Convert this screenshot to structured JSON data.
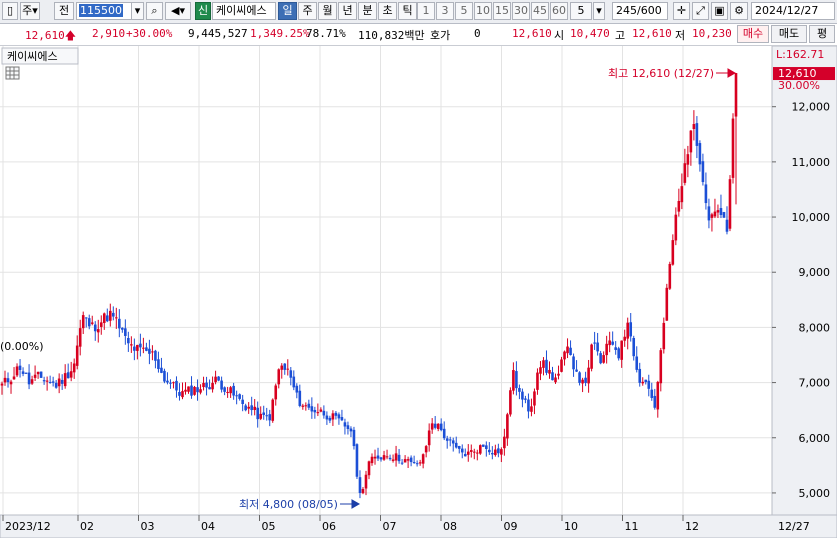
{
  "toolbar": {
    "menu1": "주",
    "menu2": "전",
    "stock_code": "115500",
    "credit_badge": "신",
    "stock_name": "케이씨에스",
    "periods": [
      "일",
      "주",
      "월",
      "년",
      "분",
      "초",
      "틱"
    ],
    "selected_period": "일",
    "intervals": [
      "1",
      "3",
      "5",
      "10",
      "15",
      "30",
      "45",
      "60"
    ],
    "custom_interval": "5",
    "count": "245",
    "count_max": "/600",
    "date": "2024/12/27"
  },
  "quote": {
    "price": "12,610",
    "change": "2,910",
    "change_pct": "+30.00%",
    "volume": "9,445,527",
    "volume_ratio": "1,349.25%",
    "turnover_pct": "78.71%",
    "amount": "110,832백만",
    "hoga_label": "호가",
    "hoga_value": "0",
    "hoga_price": "12,610",
    "open_label": "시",
    "open": "10,470",
    "high_label": "고",
    "high": "12,610",
    "low_label": "저",
    "low": "10,230",
    "buy_button": "매수",
    "sell_button": "매도",
    "avg_button": "평"
  },
  "chart_panel": {
    "stock_label": "케이씨에스",
    "left_edge_label": "(0.00%)",
    "right_top_label": "L:162.71",
    "current_price_tag": "12,610",
    "current_pct_tag": "30.00%"
  },
  "chart_data": {
    "type": "candlestick",
    "title": "",
    "ylim": [
      4600,
      13100
    ],
    "y_ticks": [
      5000,
      6000,
      7000,
      8000,
      9000,
      10000,
      11000,
      12000
    ],
    "y_tick_labels": [
      "5,000",
      "6,000",
      "7,000",
      "8,000",
      "9,000",
      "10,000",
      "11,000",
      "12,000"
    ],
    "x_tick_labels": [
      "2023/12",
      "02",
      "03",
      "04",
      "05",
      "06",
      "07",
      "08",
      "09",
      "10",
      "11",
      "12"
    ],
    "x_end_label": "12/27",
    "annotations": {
      "high": {
        "label": "최고 12,610 (12/27)",
        "value": 12610
      },
      "low": {
        "label": "최저 4,800 (08/05)",
        "value": 4800
      }
    },
    "anchor_prices": [
      6950,
      7100,
      7300,
      7000,
      7100,
      7050,
      6950,
      7100,
      7300,
      8200,
      8000,
      8100,
      8250,
      8050,
      7700,
      7600,
      7550,
      7500,
      7100,
      6950,
      6800,
      6850,
      6900,
      6950,
      7050,
      6900,
      6750,
      6600,
      6500,
      6350,
      6400,
      7300,
      7200,
      6700,
      6550,
      6500,
      6450,
      6350,
      6250,
      6150,
      4950,
      5550,
      5650,
      5700,
      5650,
      5600,
      5500,
      5600,
      6300,
      6150,
      5900,
      5750,
      5700,
      5800,
      5850,
      5750,
      5800,
      7200,
      6700,
      6500,
      7400,
      7200,
      7050,
      7600,
      7300,
      6900,
      7700,
      7350,
      7800,
      7500,
      8200,
      7100,
      7000,
      6550,
      8200,
      9700,
      10600,
      11700,
      11100,
      10000,
      10200,
      9700,
      12610
    ],
    "colors": {
      "up": "#d8001f",
      "down": "#1c4fd6",
      "grid": "#e3e3e3",
      "axis_bg": "#eef0f4"
    }
  }
}
